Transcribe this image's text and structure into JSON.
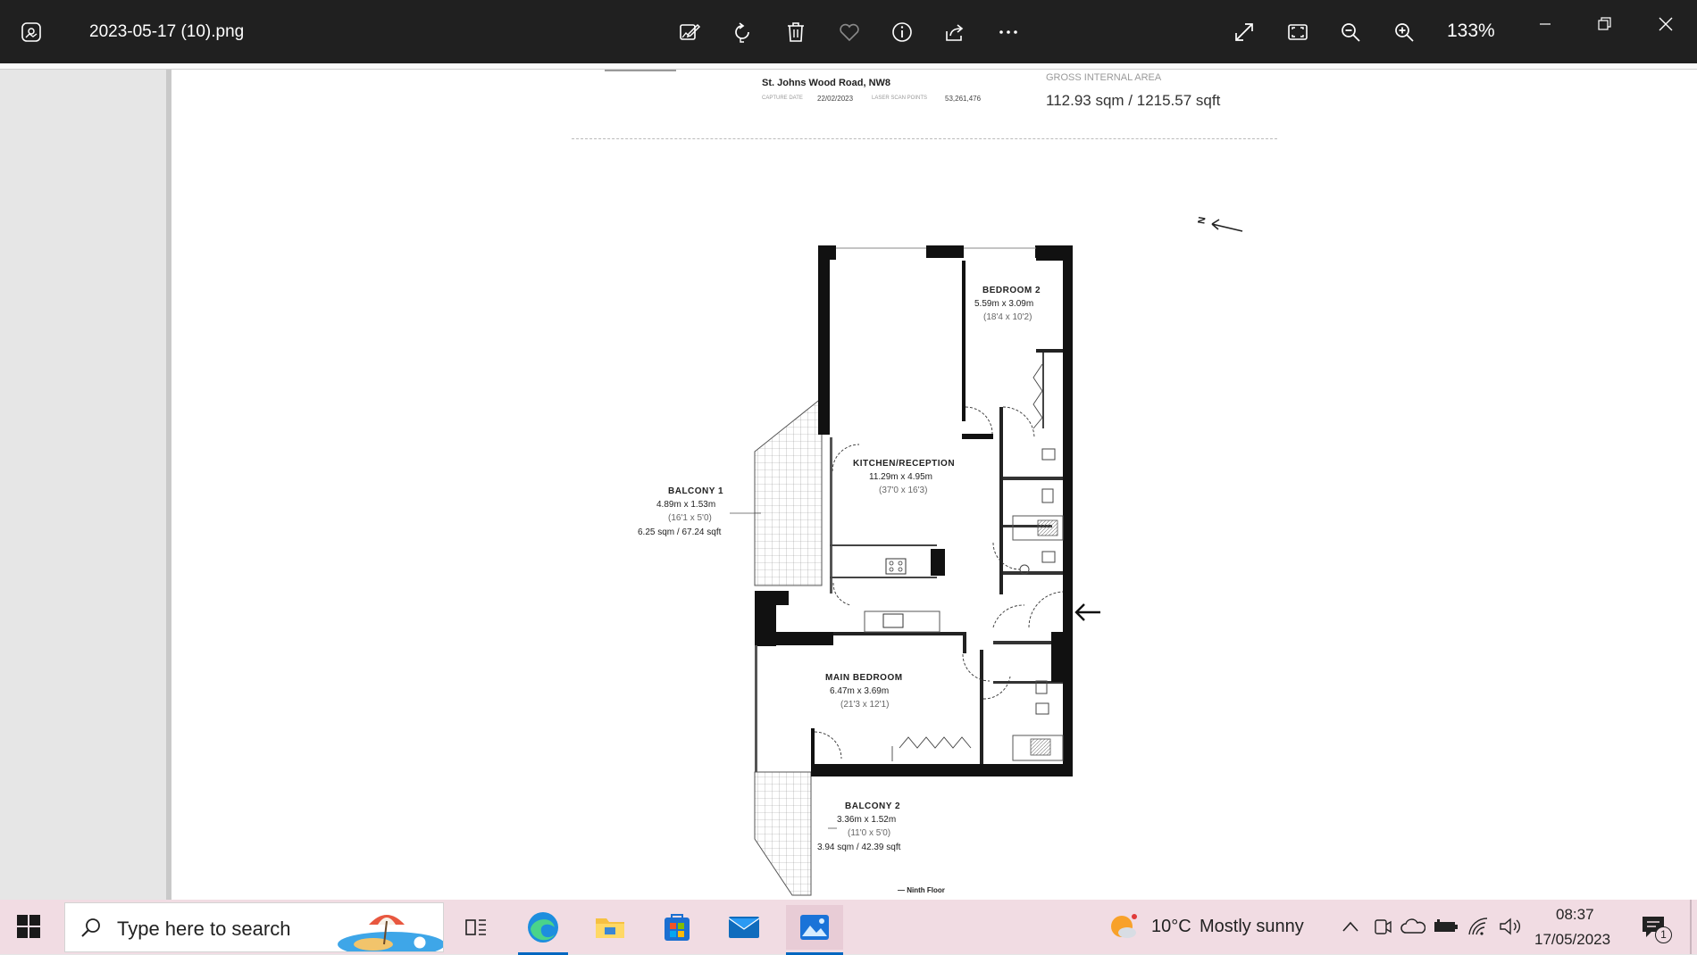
{
  "app": {
    "file_name": "2023-05-17 (10).png",
    "zoom_level": "133%"
  },
  "toolbar": {
    "icons": [
      "photos-app-icon",
      "edit-image-icon",
      "rotate-icon",
      "delete-icon",
      "favorite-icon",
      "info-icon",
      "share-icon",
      "more-icon",
      "fullscreen-icon",
      "fit-window-icon",
      "zoom-out-icon",
      "zoom-in-icon",
      "minimize-icon",
      "restore-icon",
      "close-icon"
    ]
  },
  "floorplan": {
    "address": "St. Johns Wood Road, NW8",
    "capture_date_label": "CAPTURE DATE",
    "capture_date": "22/02/2023",
    "scan_points_label": "LASER SCAN POINTS",
    "scan_points": "53,261,476",
    "gia_label": "GROSS INTERNAL AREA",
    "gia_value": "112.93 sqm / 1215.57 sqft",
    "north_label": "N",
    "floor_label": "— Ninth Floor",
    "rooms": {
      "bedroom2": {
        "name": "BEDROOM 2",
        "metric": "5.59m x 3.09m",
        "imperial": "(18'4 x 10'2)"
      },
      "kitchen": {
        "name": "KITCHEN/RECEPTION",
        "metric": "11.29m x 4.95m",
        "imperial": "(37'0 x 16'3)"
      },
      "balcony1": {
        "name": "BALCONY 1",
        "metric": "4.89m x 1.53m",
        "imperial": "(16'1 x 5'0)",
        "area": "6.25 sqm / 67.24 sqft"
      },
      "main_bedroom": {
        "name": "MAIN BEDROOM",
        "metric": "6.47m x 3.69m",
        "imperial": "(21'3 x 12'1)"
      },
      "balcony2": {
        "name": "BALCONY 2",
        "metric": "3.36m x 1.52m",
        "imperial": "(11'0 x 5'0)",
        "area": "3.94 sqm / 42.39 sqft"
      }
    }
  },
  "taskbar": {
    "search_placeholder": "Type here to search",
    "apps": [
      "task-view-icon",
      "edge-icon",
      "file-explorer-icon",
      "microsoft-store-icon",
      "mail-icon",
      "photos-icon"
    ],
    "weather_temp": "10°C",
    "weather_desc": "Mostly sunny",
    "time": "08:37",
    "date": "17/05/2023",
    "notification_count": "1",
    "colors": {
      "taskbar_bg": "#f1dce3",
      "active_indicator": "#0067c0",
      "titlebar_bg": "#202020"
    }
  }
}
